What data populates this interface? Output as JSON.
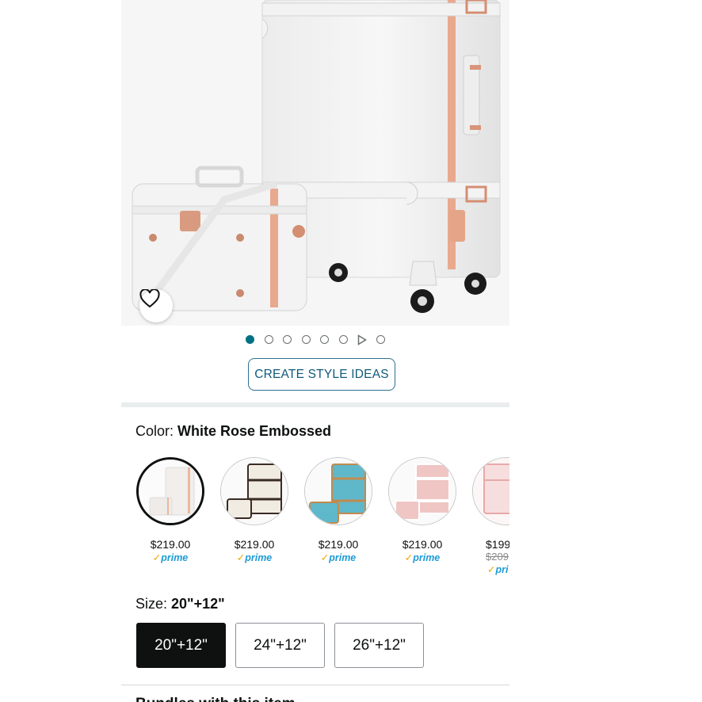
{
  "image_carousel": {
    "dots": [
      {
        "type": "dot",
        "active": true
      },
      {
        "type": "dot",
        "active": false
      },
      {
        "type": "dot",
        "active": false
      },
      {
        "type": "dot",
        "active": false
      },
      {
        "type": "dot",
        "active": false
      },
      {
        "type": "dot",
        "active": false
      },
      {
        "type": "video",
        "active": false
      },
      {
        "type": "dot",
        "active": false
      }
    ],
    "wishlist_icon": "heart-icon"
  },
  "create_style_ideas_label": "CREATE STYLE IDEAS",
  "color": {
    "label": "Color: ",
    "selected": "White Rose Embossed",
    "options": [
      {
        "price": "$219.00",
        "prime": "prime",
        "selected": true,
        "colors": [
          "#f4f1ee",
          "#e9b8a0"
        ]
      },
      {
        "price": "$219.00",
        "prime": "prime",
        "selected": false,
        "colors": [
          "#f1ece2",
          "#3a2b24"
        ]
      },
      {
        "price": "$219.00",
        "prime": "prime",
        "selected": false,
        "colors": [
          "#5fb8c9",
          "#c28a4e"
        ]
      },
      {
        "price": "$219.00",
        "prime": "prime",
        "selected": false,
        "colors": [
          "#efc6c4",
          "#ffffff"
        ]
      },
      {
        "price": "$199",
        "old_price": "$209",
        "prime": "pri",
        "selected": false,
        "colors": [
          "#f6dede",
          "#e7a9a9"
        ]
      }
    ]
  },
  "size": {
    "label": "Size: ",
    "selected": "20\"+12\"",
    "options": [
      {
        "label": "20\"+12\"",
        "selected": true
      },
      {
        "label": "24\"+12\"",
        "selected": false
      },
      {
        "label": "26\"+12\"",
        "selected": false
      }
    ]
  },
  "bundle_heading": "Bundles with this item",
  "colors": {
    "accent": "#007185",
    "button_border": "#2f6f90",
    "prime_blue": "#1d9bd6",
    "prime_check": "#f0a600"
  }
}
